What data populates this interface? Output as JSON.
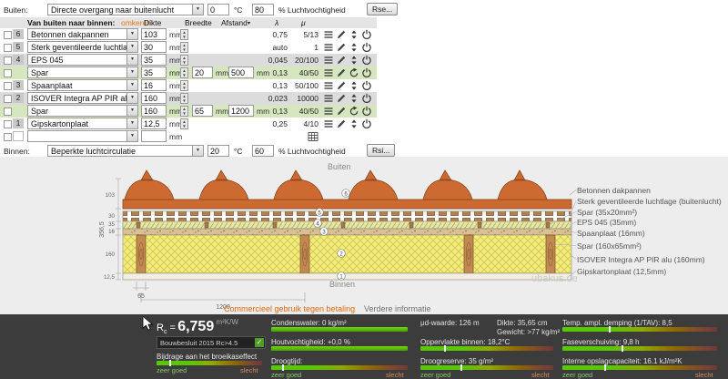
{
  "form": {
    "units": {
      "mm": "mm",
      "degrees": "°C",
      "humidity": "% Luchtvochtigheid"
    },
    "buiten": {
      "label": "Buiten:",
      "selected": "Directe overgang naar buitenlucht",
      "temperature": "0",
      "humidity": "80",
      "button": "Rse..."
    },
    "binnen": {
      "label": "Binnen:",
      "selected": "Beperkte luchtcirculatie",
      "temperature": "20",
      "humidity": "60",
      "button": "Rsi..."
    },
    "header": {
      "title": "Van buiten naar binnen:",
      "omkeren": "omkeren",
      "dikte": "Dikte",
      "breedte": "Breedte",
      "afstand": "Afstand",
      "lambda": "λ",
      "mu": "μ"
    },
    "rows": [
      {
        "num": "6",
        "name": "Betonnen dakpannen",
        "dikte": "103",
        "lambda": "0,75",
        "mu": "5/13"
      },
      {
        "num": "5",
        "name": "Sterk geventileerde luchtlage (buitenlucht)",
        "dikte": "30",
        "lambda": "auto",
        "mu": "1"
      },
      {
        "num": "4",
        "name": "EPS 045",
        "dikte": "35",
        "lambda": "0,045",
        "mu": "20/100"
      },
      {
        "num": "",
        "name": "Spar",
        "dikte": "35",
        "breedte": "20",
        "afstand": "500",
        "lambda": "0,13",
        "mu": "40/50"
      },
      {
        "num": "3",
        "name": "Spaanplaat",
        "dikte": "16",
        "lambda": "0,13",
        "mu": "50/100"
      },
      {
        "num": "2",
        "name": "ISOVER Integra AP PIR alu",
        "dikte": "160",
        "lambda": "0,023",
        "mu": "10000"
      },
      {
        "num": "",
        "name": "Spar",
        "dikte": "160",
        "breedte": "65",
        "afstand": "1200",
        "lambda": "0,13",
        "mu": "40/50"
      },
      {
        "num": "1",
        "name": "Gipskartonplaat",
        "dikte": "12,5",
        "lambda": "0,25",
        "mu": "4/10"
      },
      {
        "num": "",
        "name": "",
        "dikte": "",
        "lambda": "",
        "mu": ""
      }
    ]
  },
  "diagram": {
    "outside_label": "Buiten",
    "inside_label": "Binnen",
    "dims_left": [
      "103",
      "30",
      "35",
      "16",
      "160",
      "12,5"
    ],
    "total_thickness": "356,5",
    "dim_width": "65",
    "dim_spacing": "1200",
    "markers": [
      "6",
      "5",
      "4",
      "3",
      "2",
      "1"
    ],
    "labels_right": [
      "Betonnen dakpannen",
      "Sterk geventileerde luchtlage (buitenlucht)",
      "Spar (35x20mm²)",
      "EPS 045 (35mm)",
      "Spaanplaat (16mm)",
      "Spar (160x65mm²)",
      "ISOVER Integra AP PIR alu (160mm)",
      "Gipskartonplaat (12,5mm)"
    ],
    "link_commercial": "Commercieel gebruik tegen betaling",
    "link_info": "Verdere informatie",
    "watermark": "ubakus.de"
  },
  "results": {
    "rc": {
      "symbol": "R",
      "sub": "c",
      "eq": "=",
      "value": "6,759",
      "unit": "m²K/W"
    },
    "bouwbesluit": "Bouwbesluit 2015 Rc>4.5",
    "check": "✓",
    "broeikas": "Bijdrage aan het broeikaseffect",
    "condenswater": "Condenswater: 0 kg/m²",
    "houtvochtigheid": "Houtvochtigheid: +0,0 %",
    "droogtijd": "Droogtijd:",
    "mud_waarde": "μd-waarde: 126 m",
    "dikte": "Dikte: 35,65 cm",
    "gewicht": "Gewicht: >77 kg/m²",
    "oppervlakte": "Oppervlakte binnen: 18,2°C",
    "droogreserve": "Droogreserve: 35 g/m²",
    "tav": "Temp. ampl. demping (1/TAV): 8,5",
    "fase": "Faseverschuiving: 9,8 h",
    "opslag": "Interne opslagcapaciteit: 16.1 kJ/m²K",
    "scale_good": "zeer goed",
    "scale_bad": "slecht"
  }
}
